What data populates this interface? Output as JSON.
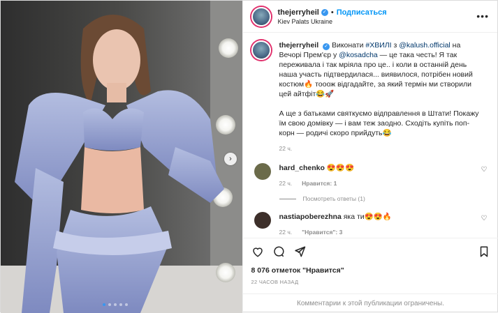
{
  "post": {
    "username": "thejerryheil",
    "follow_label": "Подписаться",
    "separator": "•",
    "location": "Kiev Palats Ukraine",
    "more_icon": "more-horizontal-icon",
    "caption": {
      "username": "thejerryheil",
      "part1": "Виконати ",
      "hashtag": "#ХВИЛІ",
      "part2": " з ",
      "mention1": "@kalush.official",
      "part3": " на Вечорі Прем'єр у ",
      "mention2": "@kosadcha",
      "part4": " — це така честь! Я так переживала і так мріяла про це.. і коли в останній день наша участь підтвердилася... виявилося, потрібен новий костюм🔥 тооож відгадайте, за який термін ми створили цей айтфіт😂🚀",
      "part5": "А ще з батьками святкуємо відправлення в Штати! Покажу їм свою домівку — і вам теж заодно. Сходіть купіть поп-корн — родичі скоро прийдуть😂",
      "time": "22 ч."
    },
    "comments": [
      {
        "username": "hard_chenko",
        "text": "😍😍😍",
        "time": "22 ч.",
        "likes": "Нравится: 1",
        "avatar_color": "#6b6b4a"
      },
      {
        "username": "nastiapoberezhna",
        "text": "яка ти😍😍🔥",
        "time": "22 ч.",
        "likes": "\"Нравится\": 3",
        "avatar_color": "#3d2f2a"
      }
    ],
    "view_replies": "Посмотреть ответы (1)",
    "likes_count": "8 076 отметок \"Нравится\"",
    "posted_ago": "22 ЧАСОВ НАЗАД",
    "comments_limited": "Комментарии к этой публикации ограничены.",
    "carousel": {
      "total_dots": 5,
      "active_index": 0
    },
    "colors": {
      "link": "#0095f6",
      "verified": "#3897f0",
      "muted": "#8e8e8e"
    }
  }
}
